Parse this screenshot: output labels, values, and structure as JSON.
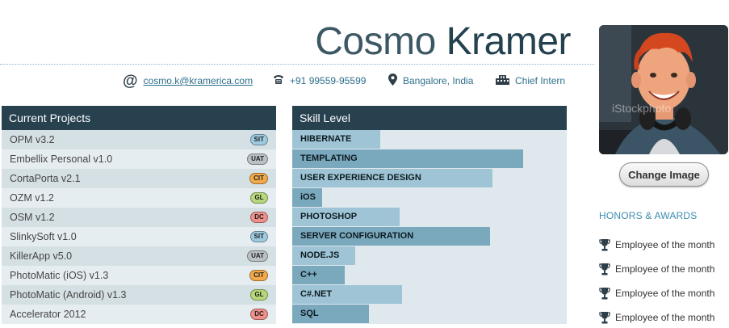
{
  "profile": {
    "first_name": "Cosmo",
    "last_name": "Kramer",
    "email": "cosmo.k@kramerica.com",
    "phone": "+91 99559-95599",
    "location": "Bangalore, India",
    "title": "Chief Intern",
    "photo_watermark": "iStockphoto"
  },
  "projects": {
    "heading": "Current Projects",
    "items": [
      {
        "name": "OPM v3.2",
        "tag": "SIT",
        "color": "#9ecbe0"
      },
      {
        "name": "Embellix Personal v1.0",
        "tag": "UAT",
        "color": "#b9c0c6"
      },
      {
        "name": "CortaPorta v2.1",
        "tag": "CIT",
        "color": "#f2a94b"
      },
      {
        "name": "OZM v1.2",
        "tag": "GL",
        "color": "#b6d77a"
      },
      {
        "name": "OSM v1.2",
        "tag": "DC",
        "color": "#ef8f8a"
      },
      {
        "name": "SlinkySoft v1.0",
        "tag": "SIT",
        "color": "#9ecbe0"
      },
      {
        "name": "KillerApp v5.0",
        "tag": "UAT",
        "color": "#b9c0c6"
      },
      {
        "name": "PhotoMatic (iOS) v1.3",
        "tag": "CIT",
        "color": "#f2a94b"
      },
      {
        "name": "PhotoMatic (Android) v1.3",
        "tag": "GL",
        "color": "#b6d77a"
      },
      {
        "name": "Accelerator 2012",
        "tag": "DC",
        "color": "#ef8f8a"
      }
    ]
  },
  "skills": {
    "heading": "Skill Level",
    "items": [
      {
        "name": "HIBERNATE",
        "level": 0.32
      },
      {
        "name": "TEMPLATING",
        "level": 0.84
      },
      {
        "name": "USER EXPERIENCE DESIGN",
        "level": 0.73
      },
      {
        "name": "iOS",
        "level": 0.11
      },
      {
        "name": "PHOTOSHOP",
        "level": 0.39
      },
      {
        "name": "SERVER CONFIGURATION",
        "level": 0.72
      },
      {
        "name": "NODE.JS",
        "level": 0.23
      },
      {
        "name": "C++",
        "level": 0.19
      },
      {
        "name": "C#.NET",
        "level": 0.4
      },
      {
        "name": "SQL",
        "level": 0.28
      }
    ]
  },
  "photo_button": "Change Image",
  "honors": {
    "heading": "HONORS & AWARDS",
    "items": [
      "Employee of the month",
      "Employee of the month",
      "Employee of the month",
      "Employee of the month"
    ]
  }
}
